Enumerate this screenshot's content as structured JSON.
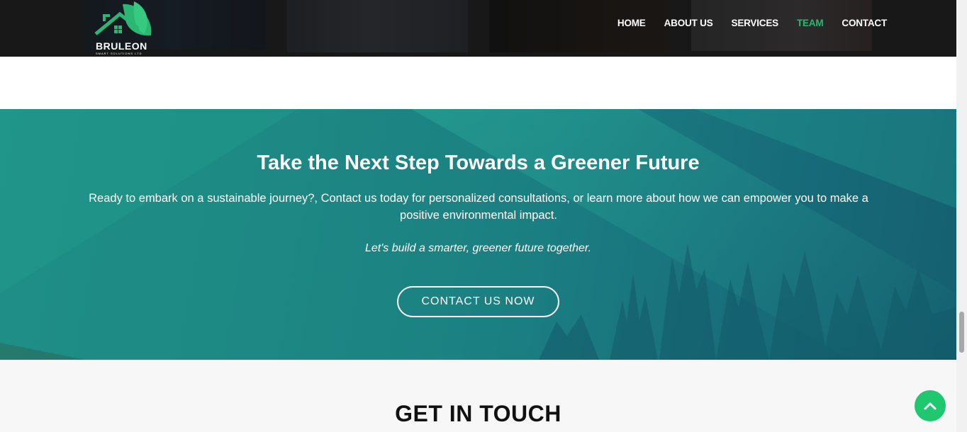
{
  "header": {
    "logo": {
      "name": "BRULEON",
      "subtitle": "SMART SOLUTIONS LTD"
    },
    "nav": [
      {
        "label": "HOME",
        "active": false
      },
      {
        "label": "ABOUT US",
        "active": false
      },
      {
        "label": "SERVICES",
        "active": false
      },
      {
        "label": "TEAM",
        "active": true
      },
      {
        "label": "CONTACT",
        "active": false
      }
    ]
  },
  "cta": {
    "title": "Take the Next Step Towards a Greener Future",
    "text": "Ready to embark on a sustainable journey?, Contact us today for personalized consultations, or learn more about how we can empower you to make a positive environmental impact.",
    "tagline": "Let's build a smarter, greener future together.",
    "button_label": "CONTACT US NOW"
  },
  "touch": {
    "title": "GET IN TOUCH"
  },
  "scroll_top": {
    "icon": "chevron-up-icon"
  },
  "colors": {
    "accent": "#2bb673",
    "header_bg": "#1e1e1e",
    "cta_bg": "#1b7f82",
    "scroll_button": "#1fc86f"
  }
}
